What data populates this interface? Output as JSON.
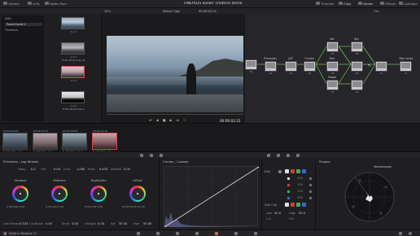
{
  "menu": {
    "gallery": "Gallery",
    "luts": "LUTs",
    "media_pool": "Media Pool",
    "title": "ONEPLUS kolder creative demo",
    "timeline": "Timeline",
    "clips": "Clips",
    "nodes": "Nodes",
    "effects": "Effects",
    "lightbox": "Lightbox"
  },
  "toolbar": {
    "zoom": "34%",
    "select_clips": "Select Clips",
    "timecode": "00:00:02:22",
    "clip": "Clip"
  },
  "gallery": {
    "tree": [
      "Stills",
      "PowerGrade 1",
      "Timelines"
    ],
    "stills": [
      {
        "id": "1.1.1",
        "name": ""
      },
      {
        "id": "1.2.1",
        "name": "Exter Node Tree 01"
      },
      {
        "id": "1.3.1",
        "name": ""
      },
      {
        "id": "1.4.1",
        "name": "Exter Node Tree 2"
      }
    ]
  },
  "viewer": {
    "timecode": "00:00:02:22"
  },
  "nodes": [
    {
      "num": "02",
      "label": "Primaries"
    },
    {
      "num": "03",
      "label": "LUT"
    },
    {
      "num": "04",
      "label": "Curves"
    },
    {
      "num": "05",
      "label": "Sat"
    },
    {
      "num": "06",
      "label": "Skin"
    },
    {
      "num": "07",
      "label": "Shape"
    },
    {
      "num": "08",
      "label": "Sky"
    },
    {
      "num": "09",
      "label": ""
    },
    {
      "num": "10",
      "label": ""
    },
    {
      "num": "11",
      "label": ""
    },
    {
      "num": "12",
      "label": "Skin tones"
    },
    {
      "num": "01",
      "label": ""
    }
  ],
  "timeline": {
    "clips": [
      {
        "tc": "00:00:20:04",
        "name": "H.265 Main L5.1"
      },
      {
        "tc": "00:00:23:12",
        "name": "H.265 Main L5.1"
      },
      {
        "tc": "00:00:26:04",
        "name": "H.265 Main L5.1"
      },
      {
        "tc": "00:00:29:18",
        "name": "H.265 Main L5.1"
      }
    ]
  },
  "primaries": {
    "title": "Primaries - Log Wheels",
    "params_top": [
      {
        "label": "Temp",
        "value": "0.0"
      },
      {
        "label": "Tint",
        "value": "0.00"
      },
      {
        "label": "Cont",
        "value": "1.000"
      },
      {
        "label": "Pivot",
        "value": "0.435"
      },
      {
        "label": "Md/Det",
        "value": "0.00"
      },
      {
        "label": "",
        "value": ""
      },
      {
        "label": "",
        "value": ""
      }
    ],
    "wheels": [
      {
        "name": "Shadow",
        "v1": "0.00",
        "v2": "0.00",
        "v3": "0.00"
      },
      {
        "name": "Midtone",
        "v1": "0.00",
        "v2": "0.00",
        "v3": "0.00"
      },
      {
        "name": "Highlights",
        "v1": "0.00",
        "v2": "0.00",
        "v3": "0.00"
      },
      {
        "name": "Offset",
        "v1": "25.00",
        "v2": "25.00",
        "v3": "25.00"
      }
    ],
    "params_bottom": [
      {
        "label": "Low Range",
        "value": "0.333"
      },
      {
        "label": "Col Boost",
        "value": "0.00"
      },
      {
        "label": "Shad",
        "value": "0.00"
      },
      {
        "label": "Hi/Light",
        "value": "0.00"
      },
      {
        "label": "Sat",
        "value": "50.00"
      },
      {
        "label": "Hue",
        "value": "50.00"
      }
    ]
  },
  "curves": {
    "title": "Curves - Custom"
  },
  "edit_panel": {
    "edit_label": "Edit",
    "values": [
      "100",
      "100",
      "100",
      "100"
    ],
    "soft_clip": "Soft Clip",
    "low": "Low",
    "low_val": "50.0",
    "high": "High",
    "high_val": "50.0",
    "ls": "L.S.",
    "hs": "H.S."
  },
  "scopes": {
    "title": "Scopes",
    "mode": "Vectorscope"
  },
  "status": {
    "app": "DaVinci Resolve 17"
  }
}
